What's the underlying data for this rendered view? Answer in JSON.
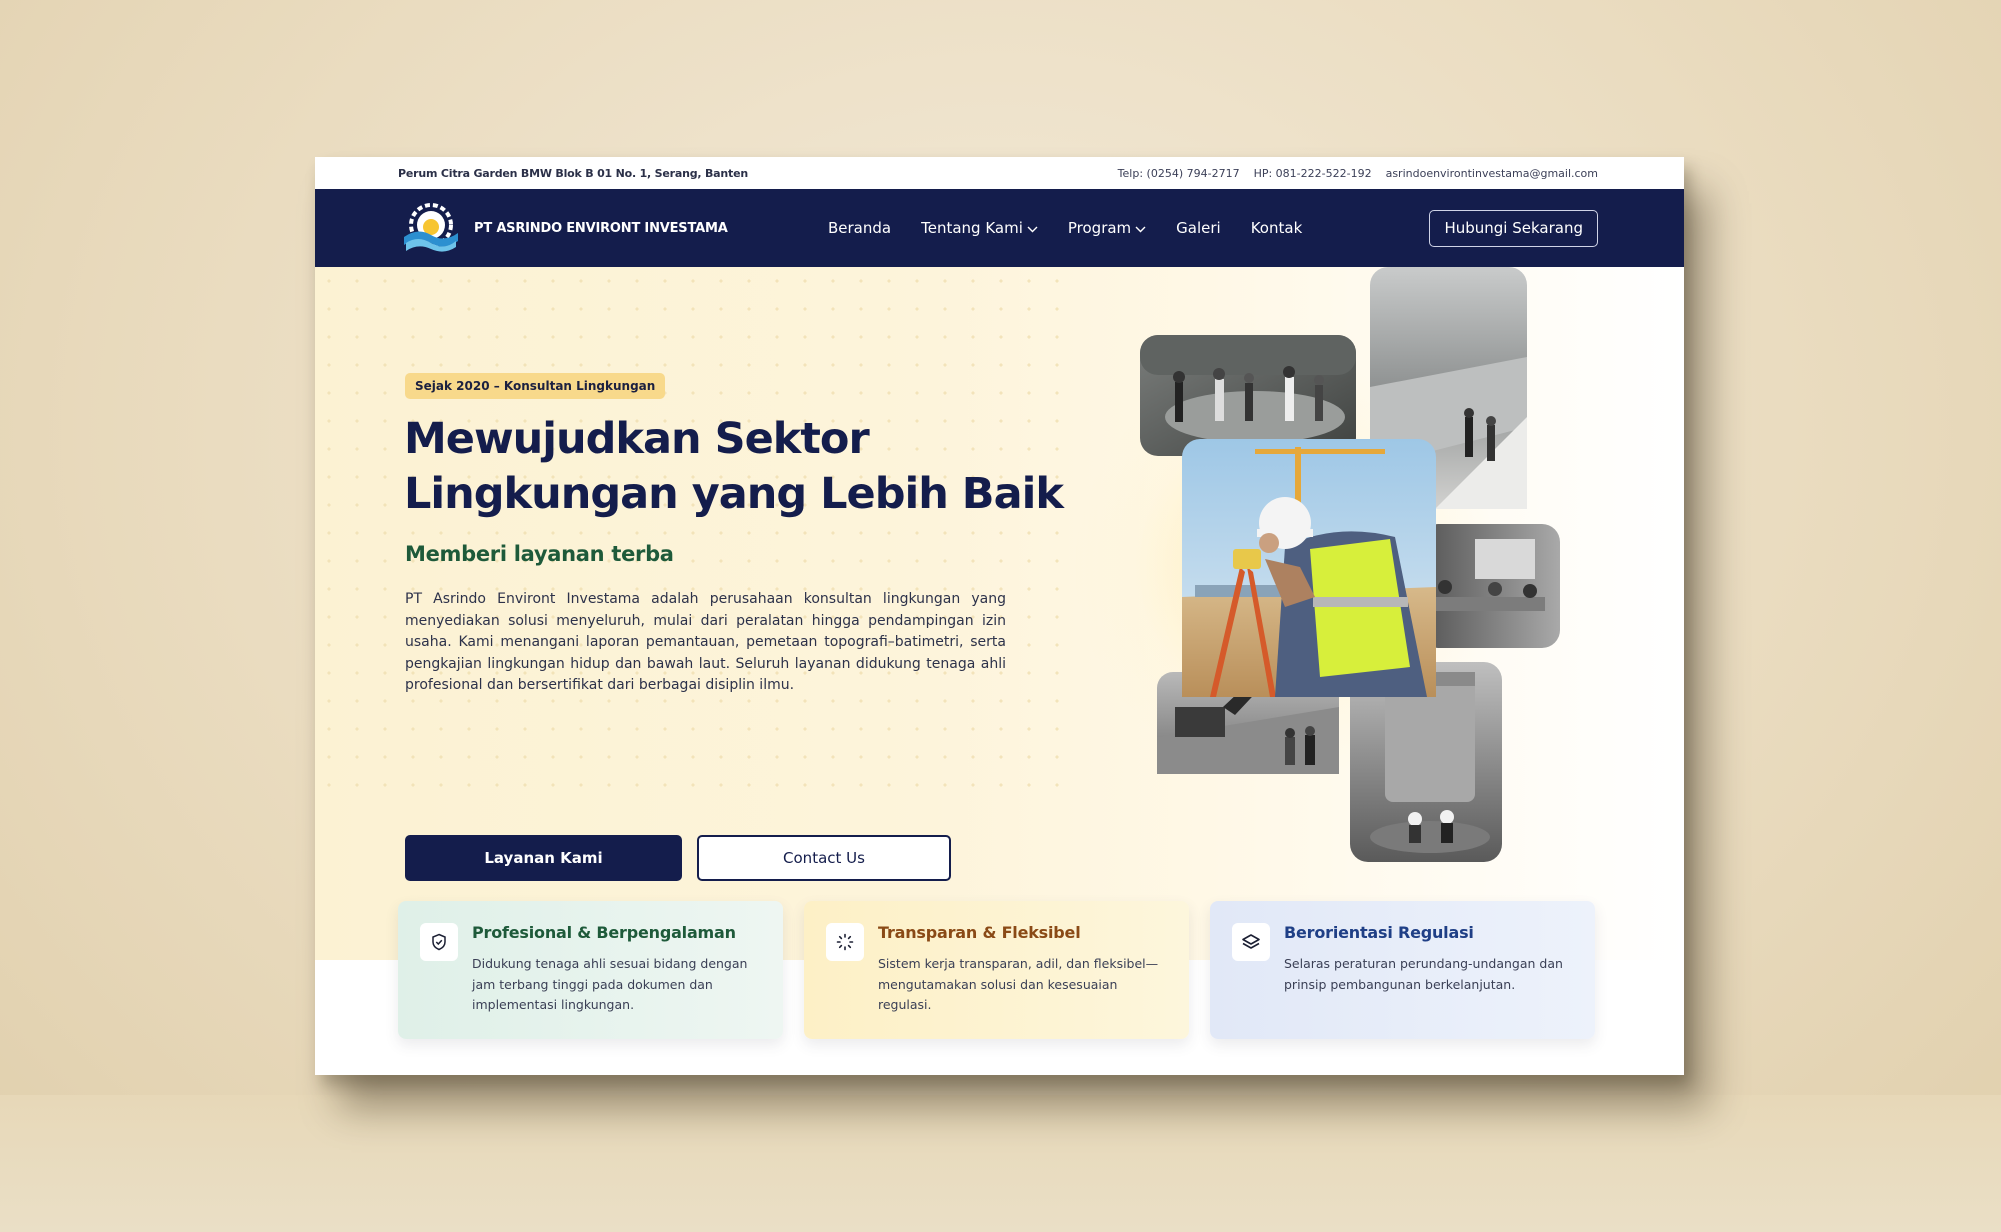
{
  "topbar": {
    "address": "Perum Citra Garden BMW Blok B 01 No. 1, Serang, Banten",
    "phone": "Telp: (0254) 794-2717",
    "mobile": "HP: 081-222-522-192",
    "email": "asrindoenvirontinvestama@gmail.com"
  },
  "nav": {
    "brand": "PT ASRINDO ENVIRONT INVESTAMA",
    "items": [
      {
        "label": "Beranda",
        "dropdown": false
      },
      {
        "label": "Tentang Kami",
        "dropdown": true
      },
      {
        "label": "Program",
        "dropdown": true
      },
      {
        "label": "Galeri",
        "dropdown": false
      },
      {
        "label": "Kontak",
        "dropdown": false
      }
    ],
    "cta": "Hubungi Sekarang"
  },
  "hero": {
    "badge": "Sejak 2020 – Konsultan Lingkungan",
    "title_line1": "Mewujudkan Sektor",
    "title_line2": "Lingkungan yang Lebih Baik",
    "subtitle": "Memberi layanan terba",
    "description": "PT Asrindo Environt Investama adalah perusahaan konsultan lingkungan yang menyediakan solusi menyeluruh, mulai dari peralatan hingga pendampingan izin usaha. Kami menangani laporan pemantauan, pemetaan topografi–batimetri, serta pengkajian lingkungan hidup dan bawah laut. Seluruh layanan didukung tenaga ahli profesional dan bersertifikat dari berbagai disiplin ilmu.",
    "primary_button": "Layanan Kami",
    "secondary_button": "Contact Us"
  },
  "features": [
    {
      "title": "Profesional & Berpengalaman",
      "description": "Didukung tenaga ahli sesuai bidang dengan jam terbang tinggi pada dokumen dan implementasi lingkungan.",
      "icon": "shield-check-icon",
      "color": "#1e5a3a"
    },
    {
      "title": "Transparan & Fleksibel",
      "description": "Sistem kerja transparan, adil, dan fleksibel—mengutamakan solusi dan kesesuaian regulasi.",
      "icon": "loader-icon",
      "color": "#8a4a16"
    },
    {
      "title": "Berorientasi Regulasi",
      "description": "Selaras peraturan perundang-undangan dan prinsip pembangunan berkelanjutan.",
      "icon": "layers-icon",
      "color": "#1f3f86"
    }
  ],
  "colors": {
    "navy": "#141d4c",
    "badge": "#f8d98b",
    "green": "#1e5a3a"
  }
}
